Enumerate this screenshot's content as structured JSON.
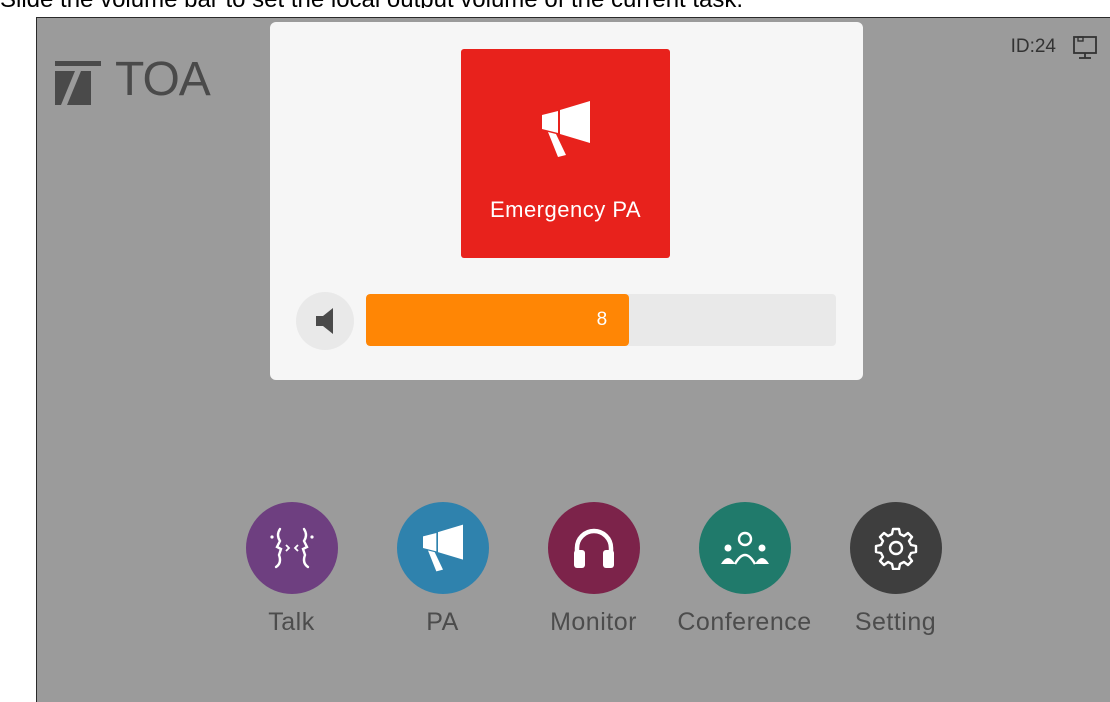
{
  "caption": "Slide the volume bar to set the local output volume of the current task.",
  "header": {
    "logo_text": "TOA",
    "device_id": "ID:24",
    "network_icon": "network-monitor-icon"
  },
  "modal": {
    "task_label": "Emergency PA",
    "task_icon": "megaphone-icon",
    "task_color": "#e8221c",
    "volume": {
      "value": "8",
      "level_percent": 56,
      "color": "#ff8605"
    },
    "speaker_icon": "speaker-icon"
  },
  "dock": {
    "apps": [
      {
        "label": "Talk",
        "icon": "talk-icon",
        "color": "#6e3f80"
      },
      {
        "label": "PA",
        "icon": "megaphone-icon",
        "color": "#2f82ad"
      },
      {
        "label": "Monitor",
        "icon": "headphones-icon",
        "color": "#7c234a"
      },
      {
        "label": "Conference",
        "icon": "conference-icon",
        "color": "#207a6b"
      },
      {
        "label": "Setting",
        "icon": "gear-icon",
        "color": "#3e3e3e"
      }
    ]
  }
}
